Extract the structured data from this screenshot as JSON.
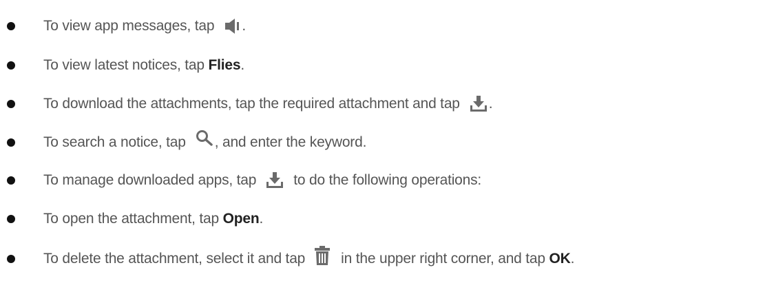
{
  "bullets": [
    {
      "before": "To view app messages, tap",
      "icon": "speaker-icon",
      "after": "."
    },
    {
      "before": "To view latest notices, tap",
      "bold": "Flies",
      "after": "."
    },
    {
      "before": "To download the attachments, tap the required attachment and tap",
      "icon": "download-icon",
      "after": "."
    },
    {
      "before": "To search a notice, tap",
      "icon": "search-icon",
      "after": ", and enter the keyword."
    },
    {
      "before": "To manage downloaded apps, tap",
      "icon": "download-icon",
      "after": "to do the following operations:"
    },
    {
      "before": "To open the attachment, tap",
      "bold": "Open",
      "after": "."
    },
    {
      "before": "To delete the attachment, select it and tap",
      "icon": "trash-icon",
      "after_text": "in the upper right corner, and tap",
      "bold": "OK",
      "after": "."
    }
  ],
  "colors": {
    "text": "#555555",
    "icon": "#6b6b6b",
    "bullet": "#111111"
  }
}
